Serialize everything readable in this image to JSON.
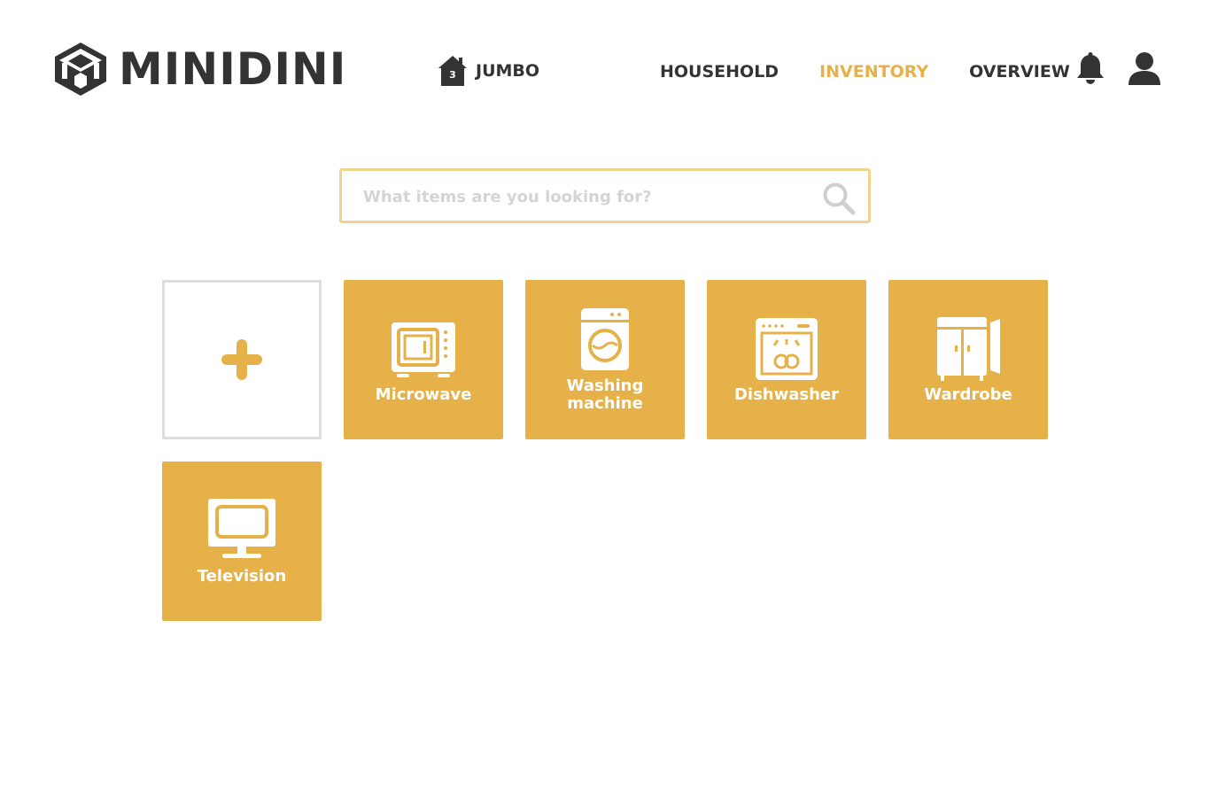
{
  "app": {
    "name": "MINIDINI"
  },
  "household": {
    "name": "JUMBO",
    "count": "3"
  },
  "nav": [
    {
      "label": "HOUSEHOLD",
      "active": false
    },
    {
      "label": "INVENTORY",
      "active": true
    },
    {
      "label": "OVERVIEW",
      "active": false
    }
  ],
  "search": {
    "placeholder": "What items are you looking for?",
    "value": ""
  },
  "tiles": [
    {
      "label": "Microwave",
      "icon": "microwave-icon"
    },
    {
      "label": "Washing machine",
      "icon": "washing-machine-icon"
    },
    {
      "label": "Dishwasher",
      "icon": "dishwasher-icon"
    },
    {
      "label": "Wardrobe",
      "icon": "wardrobe-icon"
    },
    {
      "label": "Television",
      "icon": "television-icon"
    }
  ],
  "colors": {
    "accent": "#e5b148",
    "text": "#333333",
    "search_border": "#f0d38c",
    "add_border": "#dddddd"
  }
}
